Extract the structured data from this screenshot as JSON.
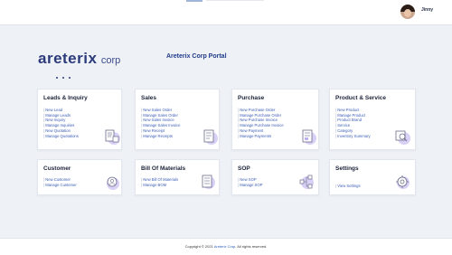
{
  "header": {
    "user_name": "Jinny"
  },
  "brand": {
    "logo_word": "areterix",
    "logo_corp": "corp",
    "portal_title": "Areterix Corp Portal"
  },
  "modules": [
    {
      "title": "Leads & Inquiry",
      "icon": "document-check-icon",
      "links": [
        "New Lead",
        "Manage Leads",
        "New Inquiry",
        "Manage Inquiries",
        "New Quotation",
        "Manage Quotations"
      ]
    },
    {
      "title": "Sales",
      "icon": "sales-invoice-icon",
      "links": [
        "New Sales Order",
        "Manage Sales Order",
        "New Sales Invoice",
        "Manage Sales Invoice",
        "New Receipt",
        "Manage Receipts"
      ]
    },
    {
      "title": "Purchase",
      "icon": "purchase-invoice-icon",
      "links": [
        "New Purchase Order",
        "Manage Purchase Order",
        "New Purchase Invoice",
        "Manage Purchase Invoice",
        "New Payment",
        "Manage Payments"
      ]
    },
    {
      "title": "Product & Service",
      "icon": "product-search-icon",
      "links": [
        "New Product",
        "Manage Product",
        "Product Brand",
        "Service",
        "Category",
        "Inventory Summary"
      ]
    },
    {
      "title": "Customer",
      "icon": "customer-badge-icon",
      "links": [
        "New Customer",
        "Manage Customer"
      ]
    },
    {
      "title": "Bill Of Materials",
      "icon": "bill-of-materials-icon",
      "links": [
        "New Bill Of Materials",
        "Manage BOM"
      ]
    },
    {
      "title": "SOP",
      "icon": "sop-flow-icon",
      "links": [
        "New SOP",
        "Manage SOP"
      ]
    },
    {
      "title": "Settings",
      "icon": "gear-icon",
      "links": [
        "View Settings"
      ]
    }
  ],
  "footer": {
    "prefix": "Copyright © 2021",
    "brand": "Areterix Corp",
    "suffix": ". All rights reserved."
  },
  "colors": {
    "accent": "#3b5db5",
    "icon_bg": "#d9d0f5",
    "background": "#eef1f6"
  }
}
